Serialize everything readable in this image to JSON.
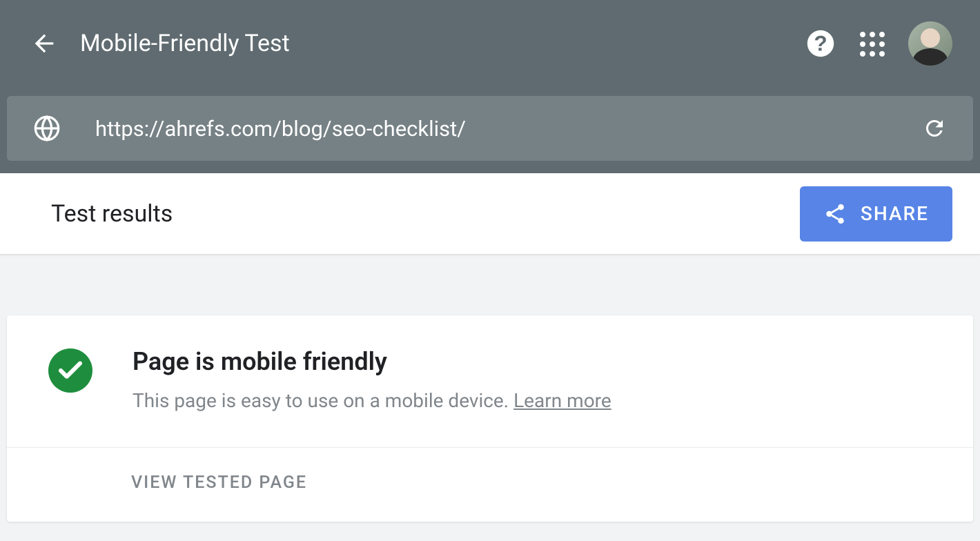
{
  "header": {
    "title": "Mobile-Friendly Test"
  },
  "url_bar": {
    "url": "https://ahrefs.com/blog/seo-checklist/"
  },
  "results": {
    "section_title": "Test results",
    "share_label": "SHARE"
  },
  "card": {
    "heading": "Page is mobile friendly",
    "subtext": "This page is easy to use on a mobile device. ",
    "learn_more": "Learn more",
    "view_tested": "VIEW TESTED PAGE"
  }
}
